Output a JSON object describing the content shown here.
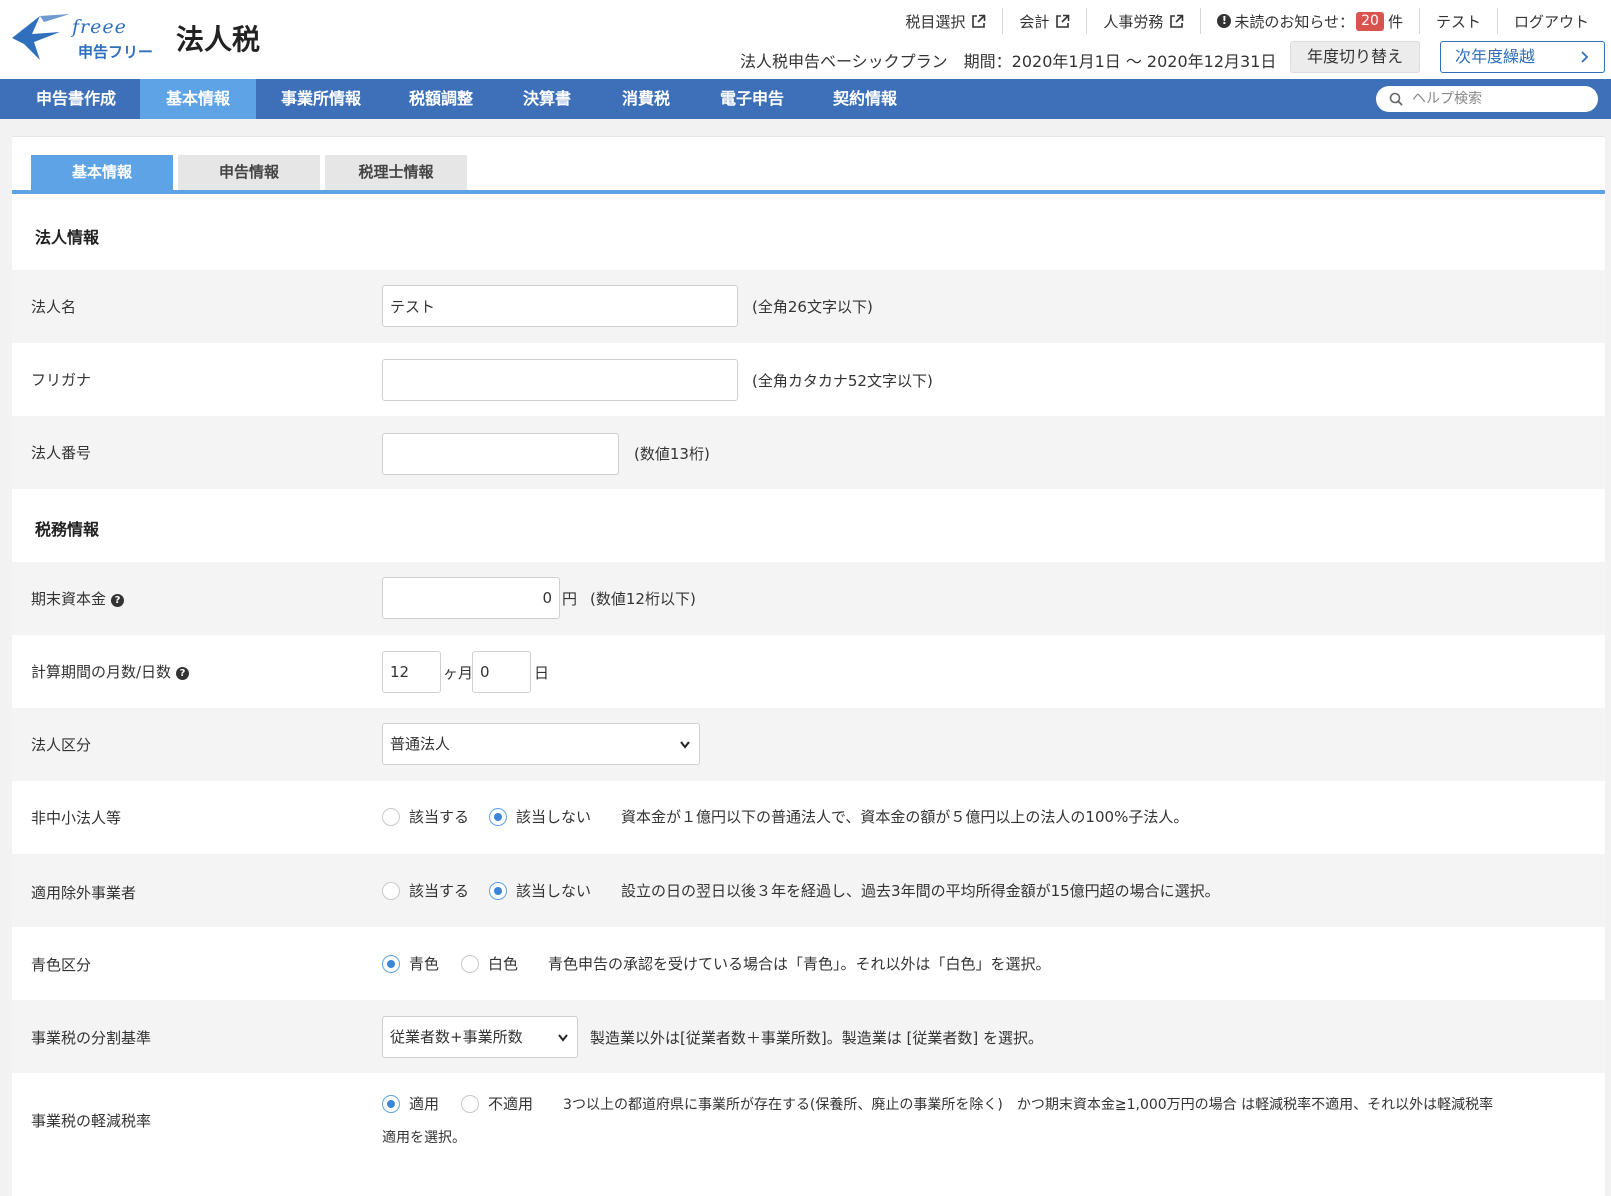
{
  "header": {
    "logo_script": "freee",
    "logo_sub": "申告フリー",
    "app_title": "法人税",
    "links": {
      "account_select": "税目選択",
      "accounting": "会計",
      "hr": "人事労務",
      "notice_prefix": "未読のお知らせ：",
      "notice_count": "20",
      "notice_suffix": "件",
      "user": "テスト",
      "logout": "ログアウト"
    },
    "plan_text": "法人税申告ベーシックプラン　期間：2020年1月1日 〜 2020年12月31日",
    "switch_year_button": "年度切り替え",
    "next_year_button": "次年度繰越"
  },
  "nav": {
    "items": [
      "申告書作成",
      "基本情報",
      "事業所情報",
      "税額調整",
      "決算書",
      "消費税",
      "電子申告",
      "契約情報"
    ],
    "active_index": 1,
    "search_placeholder": "ヘルプ検索"
  },
  "subtabs": [
    "基本情報",
    "申告情報",
    "税理士情報"
  ],
  "sections": {
    "corp_info": "法人情報",
    "tax_info": "税務情報"
  },
  "fields": {
    "corp_name": {
      "label": "法人名",
      "value": "テスト",
      "hint": "(全角26文字以下)"
    },
    "furigana": {
      "label": "フリガナ",
      "value": "",
      "hint": "(全角カタカナ52文字以下)"
    },
    "corp_number": {
      "label": "法人番号",
      "value": "",
      "hint": "(数値13桁)"
    },
    "capital": {
      "label": "期末資本金",
      "value": "0",
      "unit": "円",
      "hint": "(数値12桁以下)"
    },
    "period": {
      "label": "計算期間の月数/日数",
      "months": "12",
      "months_unit": "ヶ月",
      "days": "0",
      "days_unit": "日"
    },
    "corp_type": {
      "label": "法人区分",
      "selected": "普通法人"
    },
    "non_sme": {
      "label": "非中小法人等",
      "opt_yes": "該当する",
      "opt_no": "該当しない",
      "selected": "no",
      "hint": "資本金が１億円以下の普通法人で、資本金の額が５億円以上の法人の100%子法人。"
    },
    "excluded": {
      "label": "適用除外事業者",
      "opt_yes": "該当する",
      "opt_no": "該当しない",
      "selected": "no",
      "hint": "設立の日の翌日以後３年を経過し、過去3年間の平均所得金額が15億円超の場合に選択。"
    },
    "blue": {
      "label": "青色区分",
      "opt_blue": "青色",
      "opt_white": "白色",
      "selected": "blue",
      "hint": "青色申告の承認を受けている場合は「青色」。それ以外は「白色」を選択。"
    },
    "division": {
      "label": "事業税の分割基準",
      "selected": "従業者数+事業所数",
      "hint": "製造業以外は[従業者数＋事業所数]。製造業は [従業者数] を選択。"
    },
    "reduced": {
      "label": "事業税の軽減税率",
      "opt_apply": "適用",
      "opt_not": "不適用",
      "selected": "apply",
      "hint_line1": "3つ以上の都道府県に事業所が存在する(保養所、廃止の事業所を除く)　かつ期末資本金≧1,000万円の場合 は軽減税率不適用、それ以外は軽減税率",
      "hint_line2": "適用を選択。"
    }
  }
}
